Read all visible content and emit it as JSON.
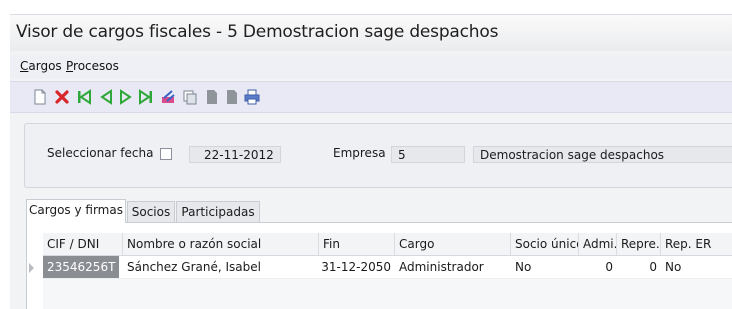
{
  "window": {
    "title": "Visor de cargos fiscales - 5 Demostracion sage despachos"
  },
  "menu": {
    "items": [
      "Cargos",
      "Procesos"
    ]
  },
  "toolbar": {
    "buttons": [
      "new-document-icon",
      "delete-icon",
      "first-record-icon",
      "previous-record-icon",
      "next-record-icon",
      "last-record-icon",
      "clear-filter-icon",
      "copy-icon",
      "page-icon",
      "page-alt-icon",
      "print-icon"
    ]
  },
  "filters": {
    "fecha_label": "Seleccionar fecha",
    "fecha_value": "22-11-2012",
    "empresa_label": "Empresa",
    "empresa_code": "5",
    "empresa_name": "Demostracion sage despachos"
  },
  "tabs": [
    "Cargos y firmas",
    "Socios",
    "Participadas"
  ],
  "grid": {
    "columns": [
      "CIF / DNI",
      "Nombre o razón social",
      "Fin",
      "Cargo",
      "Socio único",
      "Admi.",
      "Repre.",
      "Rep. ER"
    ],
    "rows": [
      {
        "cif": "23546256T",
        "nombre": "Sánchez Grané, Isabel",
        "fin": "31-12-2050",
        "cargo": "Administrador",
        "socio_unico": "No",
        "admi": "0",
        "repre": "0",
        "rep_er": "No"
      }
    ]
  }
}
